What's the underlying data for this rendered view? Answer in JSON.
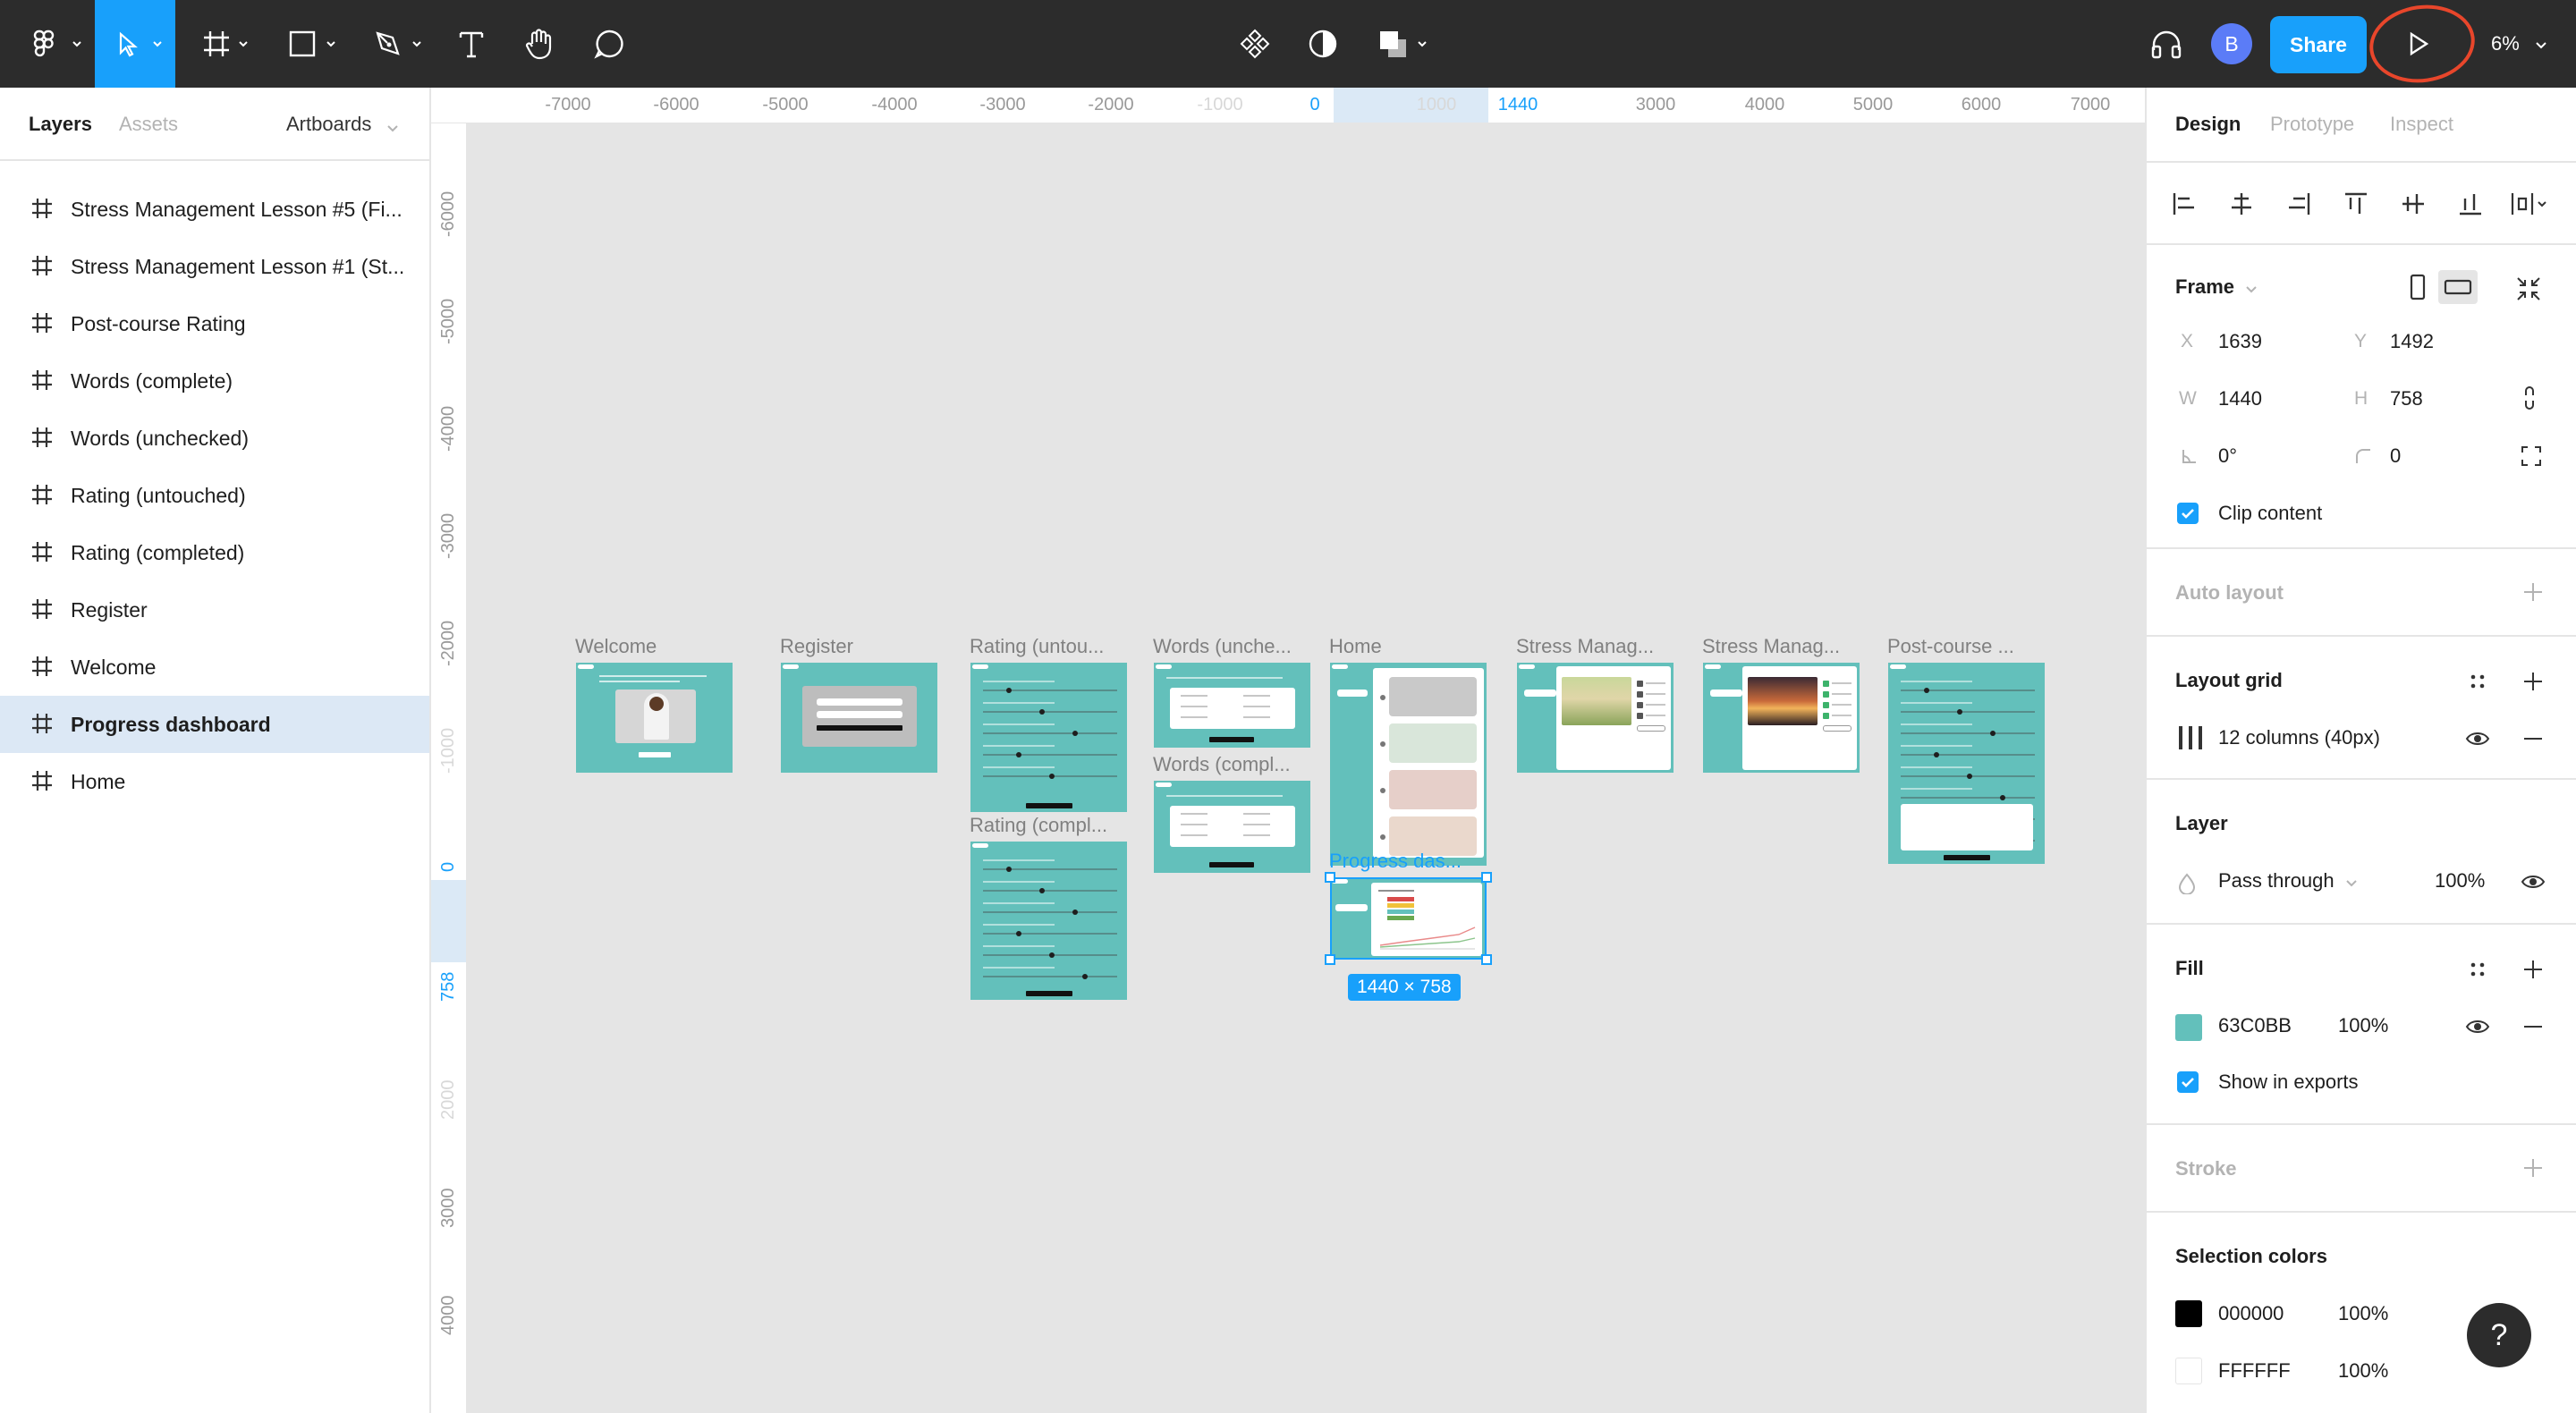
{
  "toolbar": {
    "zoom": "6%",
    "share_label": "Share",
    "avatar_initial": "B",
    "accent": "#18a0fb",
    "bg": "#2c2c2c",
    "icons": [
      "figma-menu-icon",
      "move-tool-icon",
      "frame-tool-icon",
      "shape-tool-icon",
      "pen-tool-icon",
      "text-tool-icon",
      "hand-tool-icon",
      "comment-tool-icon",
      "components-icon",
      "mask-icon",
      "boolean-ops-icon",
      "audio-headphones-icon",
      "present-play-icon"
    ]
  },
  "left_panel": {
    "tabs": [
      "Layers",
      "Assets"
    ],
    "page_selector": "Artboards",
    "layers": [
      {
        "name": "Stress Management Lesson #5 (Fi..."
      },
      {
        "name": "Stress Management Lesson #1 (St..."
      },
      {
        "name": "Post-course Rating"
      },
      {
        "name": "Words (complete)"
      },
      {
        "name": "Words (unchecked)"
      },
      {
        "name": "Rating (untouched)"
      },
      {
        "name": "Rating (completed)"
      },
      {
        "name": "Register"
      },
      {
        "name": "Welcome"
      },
      {
        "name": "Progress dashboard",
        "selected": true
      },
      {
        "name": "Home"
      }
    ]
  },
  "rulers": {
    "top": [
      "-7000",
      "-6000",
      "-5000",
      "-4000",
      "-3000",
      "-2000",
      "-1000",
      "0",
      "1000",
      "1440",
      "3000",
      "4000",
      "5000",
      "6000",
      "7000"
    ],
    "left": [
      "-6000",
      "-5000",
      "-4000",
      "-3000",
      "-2000",
      "-1000",
      "0",
      "758",
      "2000",
      "3000",
      "4000"
    ]
  },
  "canvas": {
    "frames": [
      {
        "label": "Welcome"
      },
      {
        "label": "Register"
      },
      {
        "label": "Rating (untou..."
      },
      {
        "label": "Words (unche..."
      },
      {
        "label": "Words (compl..."
      },
      {
        "label": "Rating (compl..."
      },
      {
        "label": "Home"
      },
      {
        "label": "Stress Manag..."
      },
      {
        "label": "Stress Manag..."
      },
      {
        "label": "Post-course ..."
      },
      {
        "label": "Progress das...",
        "selected": true
      }
    ],
    "selection_size": "1440 × 758",
    "frame_color": "#63c0bb"
  },
  "right_panel": {
    "tabs": [
      "Design",
      "Prototype",
      "Inspect"
    ],
    "frame_section": {
      "title": "Frame",
      "x_label": "X",
      "x": "1639",
      "y_label": "Y",
      "y": "1492",
      "w_label": "W",
      "w": "1440",
      "h_label": "H",
      "h": "758",
      "rotation": "0°",
      "radius": "0",
      "clip_content": "Clip content"
    },
    "auto_layout": "Auto layout",
    "layout_grid": {
      "title": "Layout grid",
      "value": "12 columns (40px)"
    },
    "layer": {
      "title": "Layer",
      "blend": "Pass through",
      "opacity": "100%"
    },
    "fill": {
      "title": "Fill",
      "hex": "63C0BB",
      "opacity": "100%",
      "color": "#63C0BB",
      "show_in_exports": "Show in exports"
    },
    "stroke": "Stroke",
    "selection_colors": {
      "title": "Selection colors",
      "items": [
        {
          "hex": "000000",
          "opacity": "100%",
          "color": "#000000"
        },
        {
          "hex": "FFFFFF",
          "opacity": "100%",
          "color": "#FFFFFF"
        }
      ]
    },
    "help": "?"
  }
}
